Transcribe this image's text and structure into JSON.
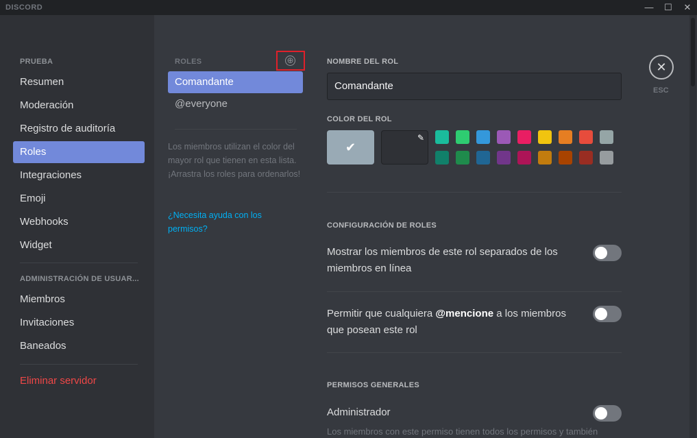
{
  "titlebar": {
    "brand": "DISCORD",
    "minimize": "—",
    "maximize": "☐",
    "close": "✕"
  },
  "sidebar": {
    "server_header": "PRUEBA",
    "items": [
      {
        "label": "Resumen"
      },
      {
        "label": "Moderación"
      },
      {
        "label": "Registro de auditoría"
      },
      {
        "label": "Roles"
      },
      {
        "label": "Integraciones"
      },
      {
        "label": "Emoji"
      },
      {
        "label": "Webhooks"
      },
      {
        "label": "Widget"
      }
    ],
    "user_admin_header": "ADMINISTRACIÓN DE USUAR...",
    "user_items": [
      {
        "label": "Miembros"
      },
      {
        "label": "Invitaciones"
      },
      {
        "label": "Baneados"
      }
    ],
    "delete_server": "Eliminar servidor"
  },
  "roles_panel": {
    "header": "ROLES",
    "add_icon": "⊕",
    "roles": [
      {
        "label": "Comandante"
      },
      {
        "label": "@everyone"
      }
    ],
    "help_text": "Los miembros utilizan el color del mayor rol que tienen en esta lista. ¡Arrastra los roles para ordenarlos!",
    "help_link": "¿Necesita ayuda con los permisos?"
  },
  "editor": {
    "role_name_label": "NOMBRE DEL ROL",
    "role_name_value": "Comandante",
    "role_color_label": "COLOR DEL ROL",
    "default_check": "✔",
    "picker_icon": "✎",
    "swatches_top": [
      "#1abc9c",
      "#2ecc71",
      "#3498db",
      "#9b59b6",
      "#e91e63",
      "#f1c40f",
      "#e67e22",
      "#e74c3c",
      "#95a5a6"
    ],
    "swatches_bottom": [
      "#11806a",
      "#1f8b4c",
      "#206694",
      "#71368a",
      "#ad1457",
      "#c27c0e",
      "#a84300",
      "#992d22",
      "#979c9f"
    ],
    "role_settings_label": "CONFIGURACIÓN DE ROLES",
    "setting1_text": "Mostrar los miembros de este rol separados de los miembros en línea",
    "setting2_pre": "Permitir que cualquiera ",
    "setting2_bold": "@mencione",
    "setting2_post": " a los miembros que posean este rol",
    "general_permissions_label": "PERMISOS GENERALES",
    "admin_label": "Administrador",
    "admin_desc": "Los miembros con este permiso tienen todos los permisos y también"
  },
  "esc": {
    "icon": "✕",
    "label": "ESC"
  }
}
